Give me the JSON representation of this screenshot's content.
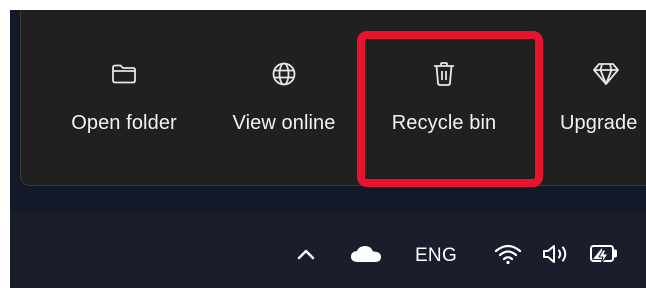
{
  "flyout": {
    "actions": [
      {
        "label": "Open folder",
        "icon": "folder-icon"
      },
      {
        "label": "View online",
        "icon": "globe-icon"
      },
      {
        "label": "Recycle bin",
        "icon": "trash-icon"
      },
      {
        "label": "Upgrade",
        "icon": "diamond-icon"
      }
    ],
    "highlight_color": "#e8132f"
  },
  "taskbar": {
    "tray": {
      "chevron_icon": "chevron-up-icon",
      "cloud_icon": "onedrive-cloud-icon",
      "language": "ENG",
      "wifi_icon": "wifi-icon",
      "volume_icon": "volume-icon",
      "battery_icon": "battery-charging-icon"
    }
  },
  "colors": {
    "flyout_bg": "#202020",
    "desktop_bg": "#14192a",
    "text": "#f2f2f2"
  }
}
